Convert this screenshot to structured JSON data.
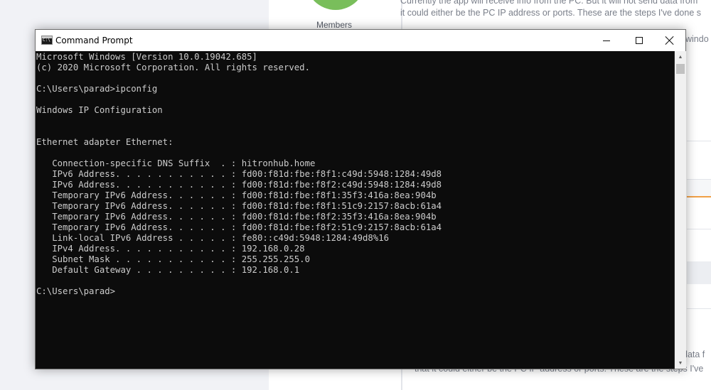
{
  "background_page": {
    "members_label": "Members",
    "post_line_1": "Currently the app will receive info from the PC.  But it will not send data from",
    "post_line_2": "it could either be the PC IP address or ports.  These are the steps I've done s",
    "post_fragment_window": "windo",
    "post_fragment_data": "data f",
    "post_line_bottom": "that it could either be the PC IP address or ports.  These are the steps I've"
  },
  "window": {
    "title": "Command Prompt",
    "icon": "cmd-icon",
    "controls": {
      "minimize": "minimize-icon",
      "maximize": "maximize-icon",
      "close": "close-icon"
    }
  },
  "console": {
    "lines": [
      "Microsoft Windows [Version 10.0.19042.685]",
      "(c) 2020 Microsoft Corporation. All rights reserved.",
      "",
      "C:\\Users\\parad>ipconfig",
      "",
      "Windows IP Configuration",
      "",
      "",
      "Ethernet adapter Ethernet:",
      "",
      "   Connection-specific DNS Suffix  . : hitronhub.home",
      "   IPv6 Address. . . . . . . . . . . : fd00:f81d:fbe:f8f1:c49d:5948:1284:49d8",
      "   IPv6 Address. . . . . . . . . . . : fd00:f81d:fbe:f8f2:c49d:5948:1284:49d8",
      "   Temporary IPv6 Address. . . . . . : fd00:f81d:fbe:f8f1:35f3:416a:8ea:904b",
      "   Temporary IPv6 Address. . . . . . : fd00:f81d:fbe:f8f1:51c9:2157:8acb:61a4",
      "   Temporary IPv6 Address. . . . . . : fd00:f81d:fbe:f8f2:35f3:416a:8ea:904b",
      "   Temporary IPv6 Address. . . . . . : fd00:f81d:fbe:f8f2:51c9:2157:8acb:61a4",
      "   Link-local IPv6 Address . . . . . : fe80::c49d:5948:1284:49d8%16",
      "   IPv4 Address. . . . . . . . . . . : 192.168.0.28",
      "   Subnet Mask . . . . . . . . . . . : 255.255.255.0",
      "   Default Gateway . . . . . . . . . : 192.168.0.1",
      "",
      "C:\\Users\\parad>"
    ],
    "text_color": "#cccccc",
    "background_color": "#0c0c0c"
  }
}
